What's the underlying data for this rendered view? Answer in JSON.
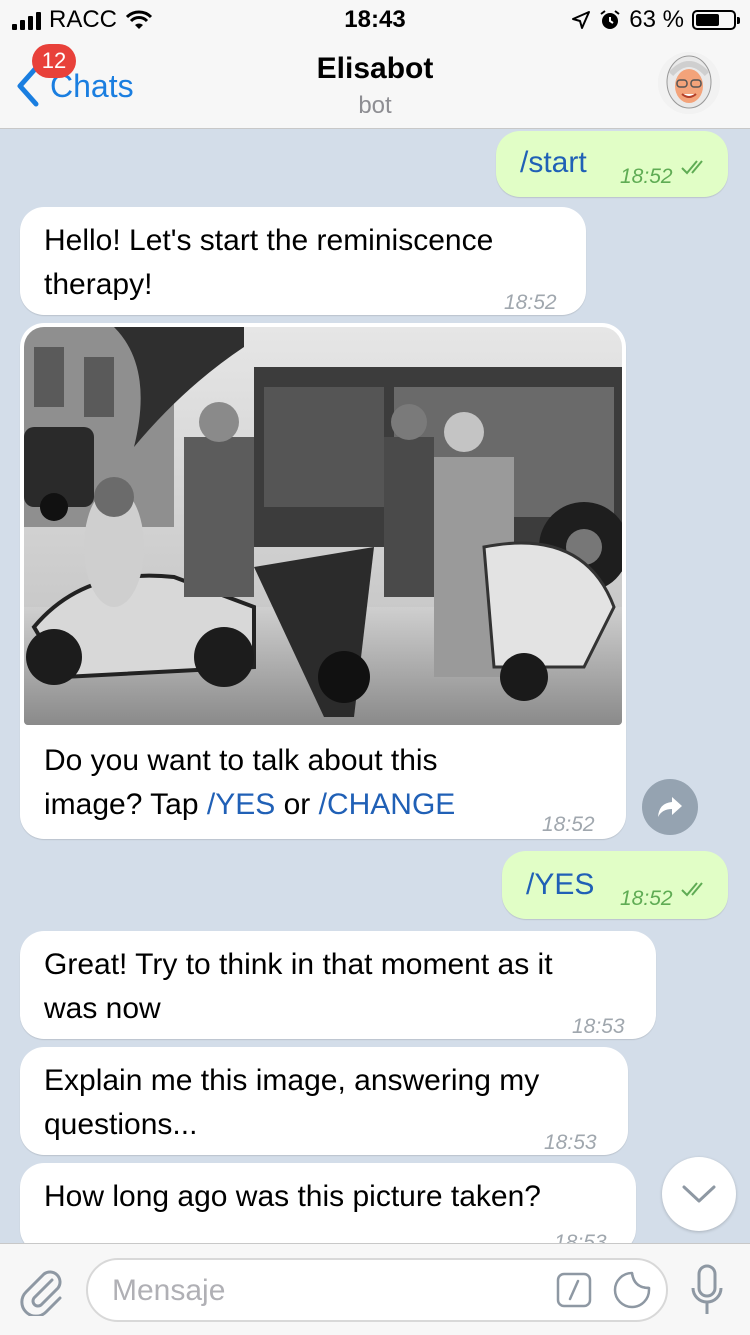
{
  "status_bar": {
    "carrier": "RACC",
    "time": "18:43",
    "battery_percent": "63 %",
    "battery_level": 0.63
  },
  "header": {
    "back_label": "Chats",
    "unread_badge": "12",
    "title": "Elisabot",
    "subtitle": "bot"
  },
  "messages": [
    {
      "direction": "out",
      "text": "/start",
      "time": "18:52"
    },
    {
      "direction": "in",
      "lines": [
        "Hello! Let's start the reminiscence",
        "therapy!"
      ],
      "time": "18:52"
    },
    {
      "direction": "in",
      "type": "photo",
      "caption_line1": "Do you want to talk about this",
      "caption_prefix": "image? Tap ",
      "cmd1": "/YES",
      "caption_mid": " or ",
      "cmd2": "/CHANGE",
      "time": "18:52"
    },
    {
      "direction": "out",
      "text": "/YES",
      "time": "18:52"
    },
    {
      "direction": "in",
      "lines": [
        "Great! Try to think in that moment as it",
        "was now"
      ],
      "time": "18:53"
    },
    {
      "direction": "in",
      "lines": [
        "Explain me this image, answering my",
        "questions..."
      ],
      "time": "18:53"
    },
    {
      "direction": "in",
      "lines": [
        "How long ago was this picture taken?"
      ],
      "time": "18:53"
    }
  ],
  "input": {
    "placeholder": "Mensaje"
  },
  "icons": {
    "signal": "signal-icon",
    "wifi": "wifi-icon",
    "location": "location-arrow-icon",
    "alarm": "alarm-icon",
    "battery": "battery-icon",
    "back": "chevron-left-icon",
    "share": "share-arrow-icon",
    "scroll_down": "chevron-down-icon",
    "attach": "paperclip-icon",
    "commands": "slash-command-icon",
    "sticker": "sticker-icon",
    "mic": "microphone-icon"
  },
  "colors": {
    "accent": "#1a7ee0",
    "badge": "#e8413a",
    "outgoing_bubble": "#e1fec6",
    "incoming_bubble": "#ffffff",
    "chat_bg": "#d3dde9",
    "command_link": "#2060b6"
  }
}
